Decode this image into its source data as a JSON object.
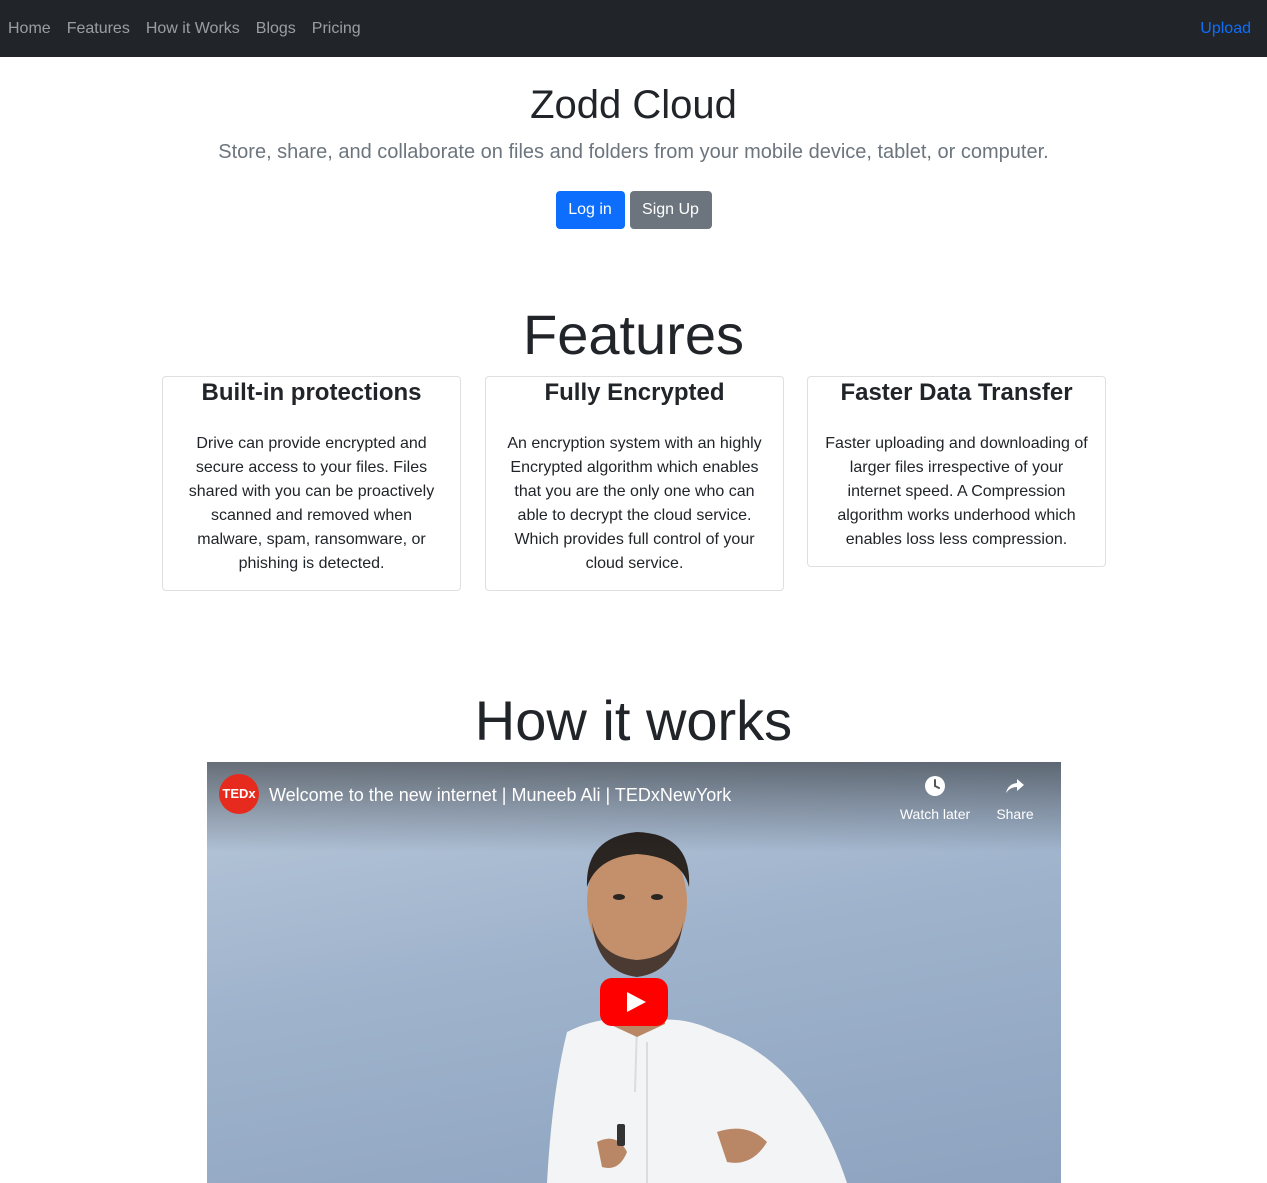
{
  "nav": {
    "links": [
      "Home",
      "Features",
      "How it Works",
      "Blogs",
      "Pricing"
    ],
    "upload": "Upload"
  },
  "hero": {
    "title": "Zodd Cloud",
    "lead": "Store, share, and collaborate on files and folders from your mobile device, tablet, or computer.",
    "login": "Log in",
    "signup": "Sign Up"
  },
  "features": {
    "title": "Features",
    "cards": [
      {
        "title": "Built-in protections",
        "text": "Drive can provide encrypted and secure access to your files. Files shared with you can be proactively scanned and removed when malware, spam, ransomware, or phishing is detected."
      },
      {
        "title": "Fully Encrypted",
        "text": "An encryption system with an highly Encrypted algorithm which enables that you are the only one who can able to decrypt the cloud service. Which provides full control of your cloud service."
      },
      {
        "title": "Faster Data Transfer",
        "text": "Faster uploading and downloading of larger files irrespective of your internet speed. A Compression algorithm works underhood which enables loss less compression."
      }
    ]
  },
  "how": {
    "title": "How it works",
    "video": {
      "channel_logo": "TEDx",
      "title": "Welcome to the new internet | Muneeb Ali | TEDxNewYork",
      "watch_later": "Watch later",
      "share": "Share"
    }
  },
  "colors": {
    "navbar": "#212529",
    "primary": "#0d6efd",
    "secondary": "#6c757d",
    "youtube_red": "#ff0000",
    "ted_red": "#e62b1e"
  },
  "icons": [
    "clock-icon",
    "share-arrow-icon",
    "play-icon"
  ]
}
